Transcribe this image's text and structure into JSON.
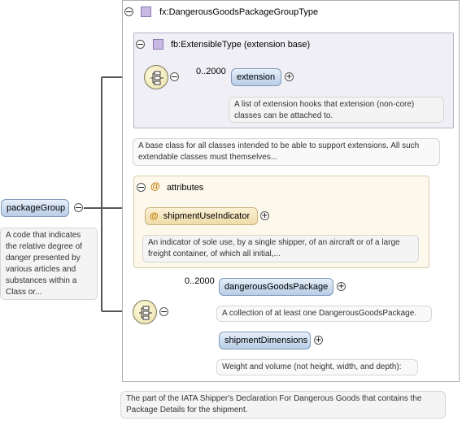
{
  "root": {
    "name": "packageGroup",
    "doc": "A code that indicates the relative degree of danger presented by various articles and substances within a Class or..."
  },
  "type_block": {
    "title": "fx:DangerousGoodsPackageGroupType",
    "doc": "The part of the IATA Shipper's Declaration For Dangerous Goods that contains the Package Details for the shipment."
  },
  "extension_base": {
    "title": "fb:ExtensibleType (extension base)",
    "doc": "A base class for all classes intended to be able to support extensions. All such extendable classes must themselves...",
    "multiplicity": "0..2000",
    "element": {
      "name": "extension",
      "doc": "A list of extension hooks that extension (non-core) classes can be attached to."
    }
  },
  "attributes": {
    "title": "attributes",
    "symbol": "@",
    "item": {
      "name": "shipmentUseIndicator",
      "doc": "An indicator of sole use, by a single shipper, of an aircraft or of a large freight container, of which all initial,..."
    }
  },
  "sequence": {
    "multiplicity": "0..2000",
    "elements": [
      {
        "name": "dangerousGoodsPackage",
        "doc": "A collection of at least one DangerousGoodsPackage."
      },
      {
        "name": "shipmentDimensions",
        "doc": "Weight and volume (not height, width, and depth):"
      }
    ]
  },
  "icons": {
    "collapse": "minus-circle-icon",
    "expand": "plus-circle-icon",
    "type": "complex-type-icon",
    "sequence": "sequence-compositor-icon",
    "attribute": "attribute-at-icon"
  },
  "colors": {
    "element_fill": "#c9dbf0",
    "element_border": "#7f9ab9",
    "extension_fill": "#f1eff6",
    "attributes_fill": "#fdf8ec",
    "doc_fill": "#f4f4f4",
    "connector": "#444444"
  }
}
